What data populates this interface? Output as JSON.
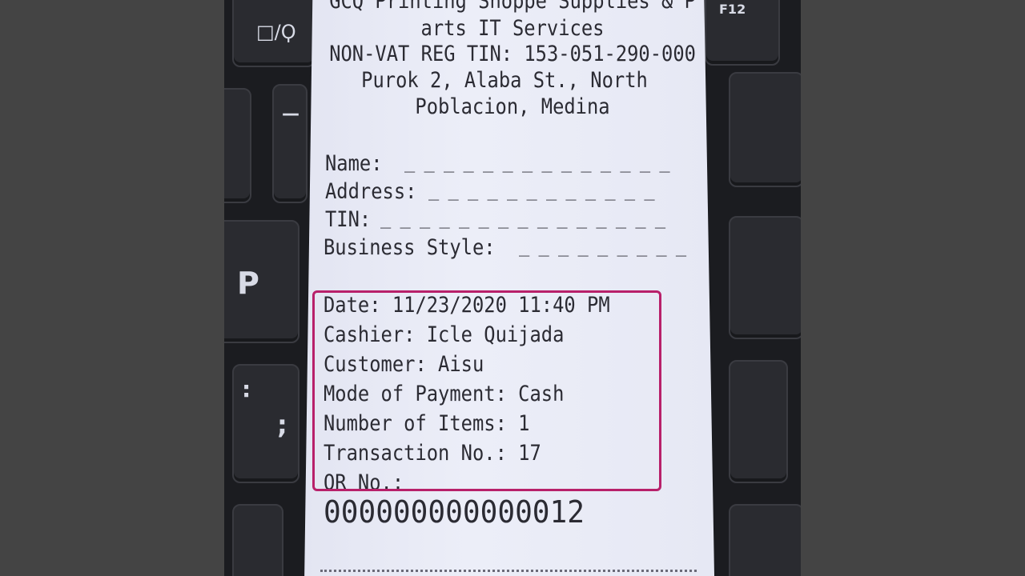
{
  "receipt": {
    "header": [
      "GCQ Printing Shoppe Supplies & P",
      "arts IT Services",
      "NON-VAT REG TIN: 153-051-290-000",
      "Purok 2, Alaba St., North",
      "Poblacion, Medina"
    ],
    "form": {
      "name": "Name:",
      "address": "Address:",
      "tin": "TIN:",
      "business_style": "Business Style:",
      "name_blank": "_ _ _ _ _ _ _ _ _ _ _ _ _ _",
      "address_blank": "_ _ _ _ _ _ _ _ _ _ _ _",
      "tin_blank": "_ _ _ _ _ _ _ _ _ _ _ _ _ _ _",
      "business_blank": "_ _ _ _ _ _ _ _ _"
    },
    "details": [
      "Date: 11/23/2020 11:40 PM",
      "Cashier: Icle Quijada",
      "Customer: Aisu",
      "Mode of Payment: Cash",
      "Number of Items: 1",
      "Transaction No.: 17",
      "OR No.:"
    ],
    "or_number": "000000000000012"
  },
  "keyboard": {
    "f12": "F12",
    "p": "P",
    "colon": ":",
    "semicolon": ";",
    "key_fragment": "□/Ϙ",
    "dash": "—"
  },
  "colors": {
    "highlight": "#b8206a",
    "paper": "#e8eaf5",
    "ink": "#2b2b33"
  }
}
